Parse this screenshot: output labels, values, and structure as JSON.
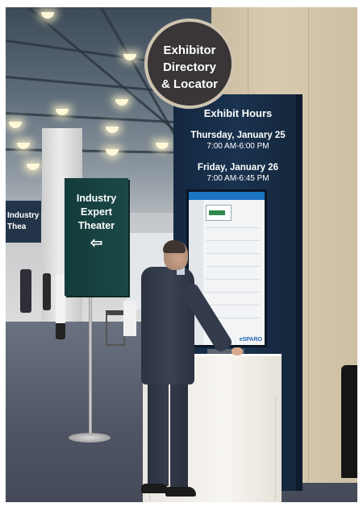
{
  "photo": {
    "round_sign": {
      "line1": "Exhibitor",
      "line2": "Directory",
      "line3": "& Locator"
    },
    "kiosk": {
      "title": "Exhibit Hours",
      "days": [
        {
          "day": "Thursday, January 25",
          "time": "7:00 AM-6:00 PM"
        },
        {
          "day": "Friday, January 26",
          "time": "7:00 AM-6:45 PM"
        }
      ],
      "screen_logo": "eSPARO"
    },
    "theater_sign": {
      "line1": "Industry",
      "line2": "Expert",
      "line3": "Theater",
      "arrow": "⇦"
    },
    "left_sign": {
      "line1": "Industry",
      "line2": "Thea"
    },
    "colors": {
      "kiosk_panel": "#1a3350",
      "theater_sign": "#1b4947",
      "round_sign": "#3a3637",
      "wall": "#d8cbb0",
      "floor": "#4f5564"
    }
  }
}
